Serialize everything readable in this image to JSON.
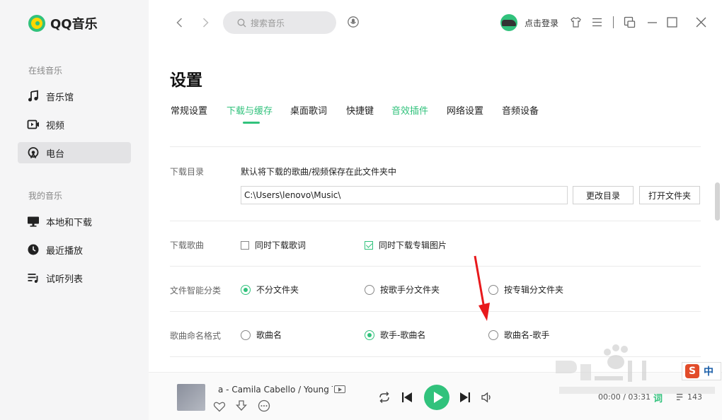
{
  "app": {
    "logo_text": "QQ音乐"
  },
  "sidebar": {
    "section_online": "在线音乐",
    "section_mine": "我的音乐",
    "online_items": [
      {
        "label": "音乐馆",
        "icon": "music-note-icon"
      },
      {
        "label": "视频",
        "icon": "video-icon"
      },
      {
        "label": "电台",
        "icon": "radio-icon",
        "active": true
      }
    ],
    "mine_items": [
      {
        "label": "本地和下载",
        "icon": "monitor-icon"
      },
      {
        "label": "最近播放",
        "icon": "clock-icon"
      },
      {
        "label": "试听列表",
        "icon": "playlist-icon"
      }
    ]
  },
  "topbar": {
    "search_placeholder": "搜索音乐",
    "login_label": "点击登录"
  },
  "page": {
    "title": "设置",
    "tabs": [
      {
        "label": "常规设置",
        "active": false
      },
      {
        "label": "下载与缓存",
        "active": true
      },
      {
        "label": "桌面歌词",
        "active": false
      },
      {
        "label": "快捷键",
        "active": false
      },
      {
        "label": "音效插件",
        "active": false,
        "highlight": true
      },
      {
        "label": "网络设置",
        "active": false
      },
      {
        "label": "音频设备",
        "active": false
      }
    ]
  },
  "settings": {
    "download_dir": {
      "label": "下载目录",
      "description": "默认将下载的歌曲/视频保存在此文件夹中",
      "path": "C:\\Users\\lenovo\\Music\\",
      "change_button": "更改目录",
      "open_button": "打开文件夹"
    },
    "download_songs": {
      "label": "下载歌曲",
      "options": [
        {
          "label": "同时下载歌词",
          "checked": false
        },
        {
          "label": "同时下载专辑图片",
          "checked": true
        }
      ]
    },
    "smart_sort": {
      "label": "文件智能分类",
      "options": [
        {
          "label": "不分文件夹",
          "selected": true
        },
        {
          "label": "按歌手分文件夹",
          "selected": false
        },
        {
          "label": "按专辑分文件夹",
          "selected": false
        }
      ]
    },
    "naming": {
      "label": "歌曲命名格式",
      "options": [
        {
          "label": "歌曲名",
          "selected": false
        },
        {
          "label": "歌手-歌曲名",
          "selected": true
        },
        {
          "label": "歌曲名-歌手",
          "selected": false
        }
      ]
    }
  },
  "player": {
    "song_text": "a - Camila Cabello / Young T",
    "time": "00:00 / 03:31",
    "lyric_label": "词",
    "playlist_count": "143"
  },
  "colors": {
    "accent": "#31c27c",
    "sidebar_bg": "#f5f5f6",
    "annotation_arrow": "#e8191c"
  }
}
